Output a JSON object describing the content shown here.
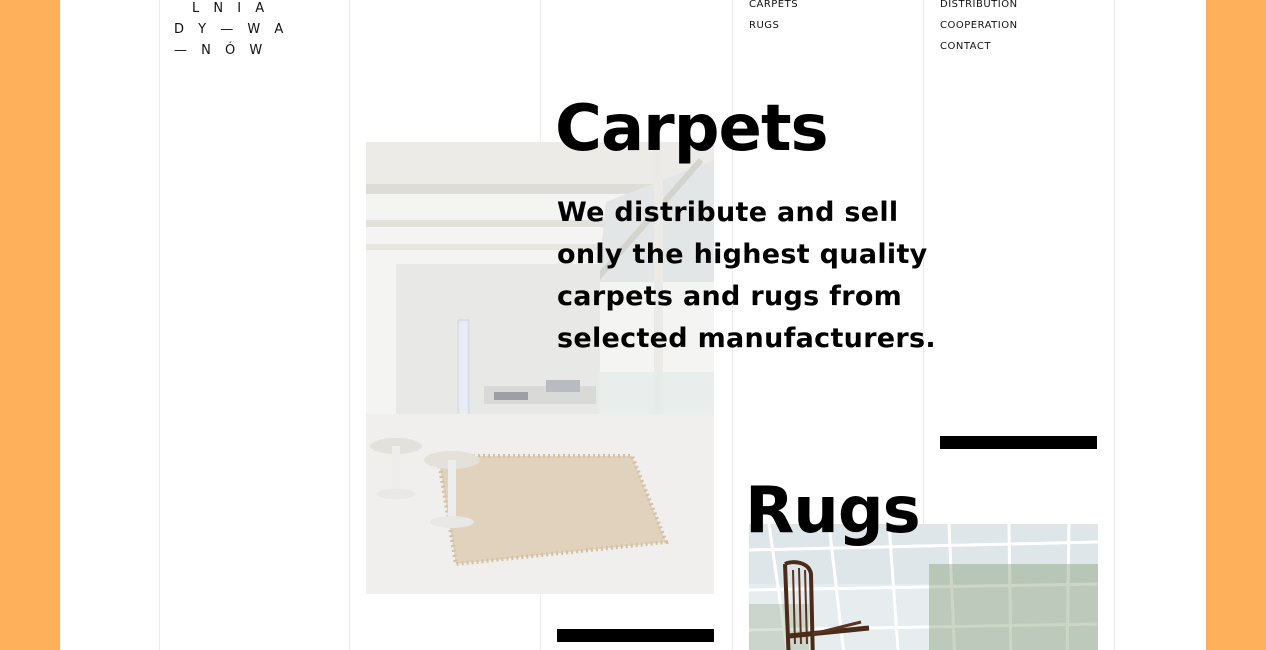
{
  "brand": {
    "logo_lines": [
      "L N I A",
      "D Y — W A",
      "— N Ó W"
    ]
  },
  "nav": {
    "col1": [
      "CARPETS",
      "RUGS"
    ],
    "col2": [
      "DISTRIBUTION",
      "COOPERATION",
      "CONTACT"
    ]
  },
  "carpets": {
    "heading": "Carpets",
    "intro": "We distribute and sell only the highest quality carpets and rugs from selected manufacturers."
  },
  "rugs": {
    "heading": "Rugs"
  },
  "colors": {
    "frame": "#FFB05A",
    "page": "#FFFFFF",
    "text": "#000000",
    "gridline": "#ECECEC"
  }
}
